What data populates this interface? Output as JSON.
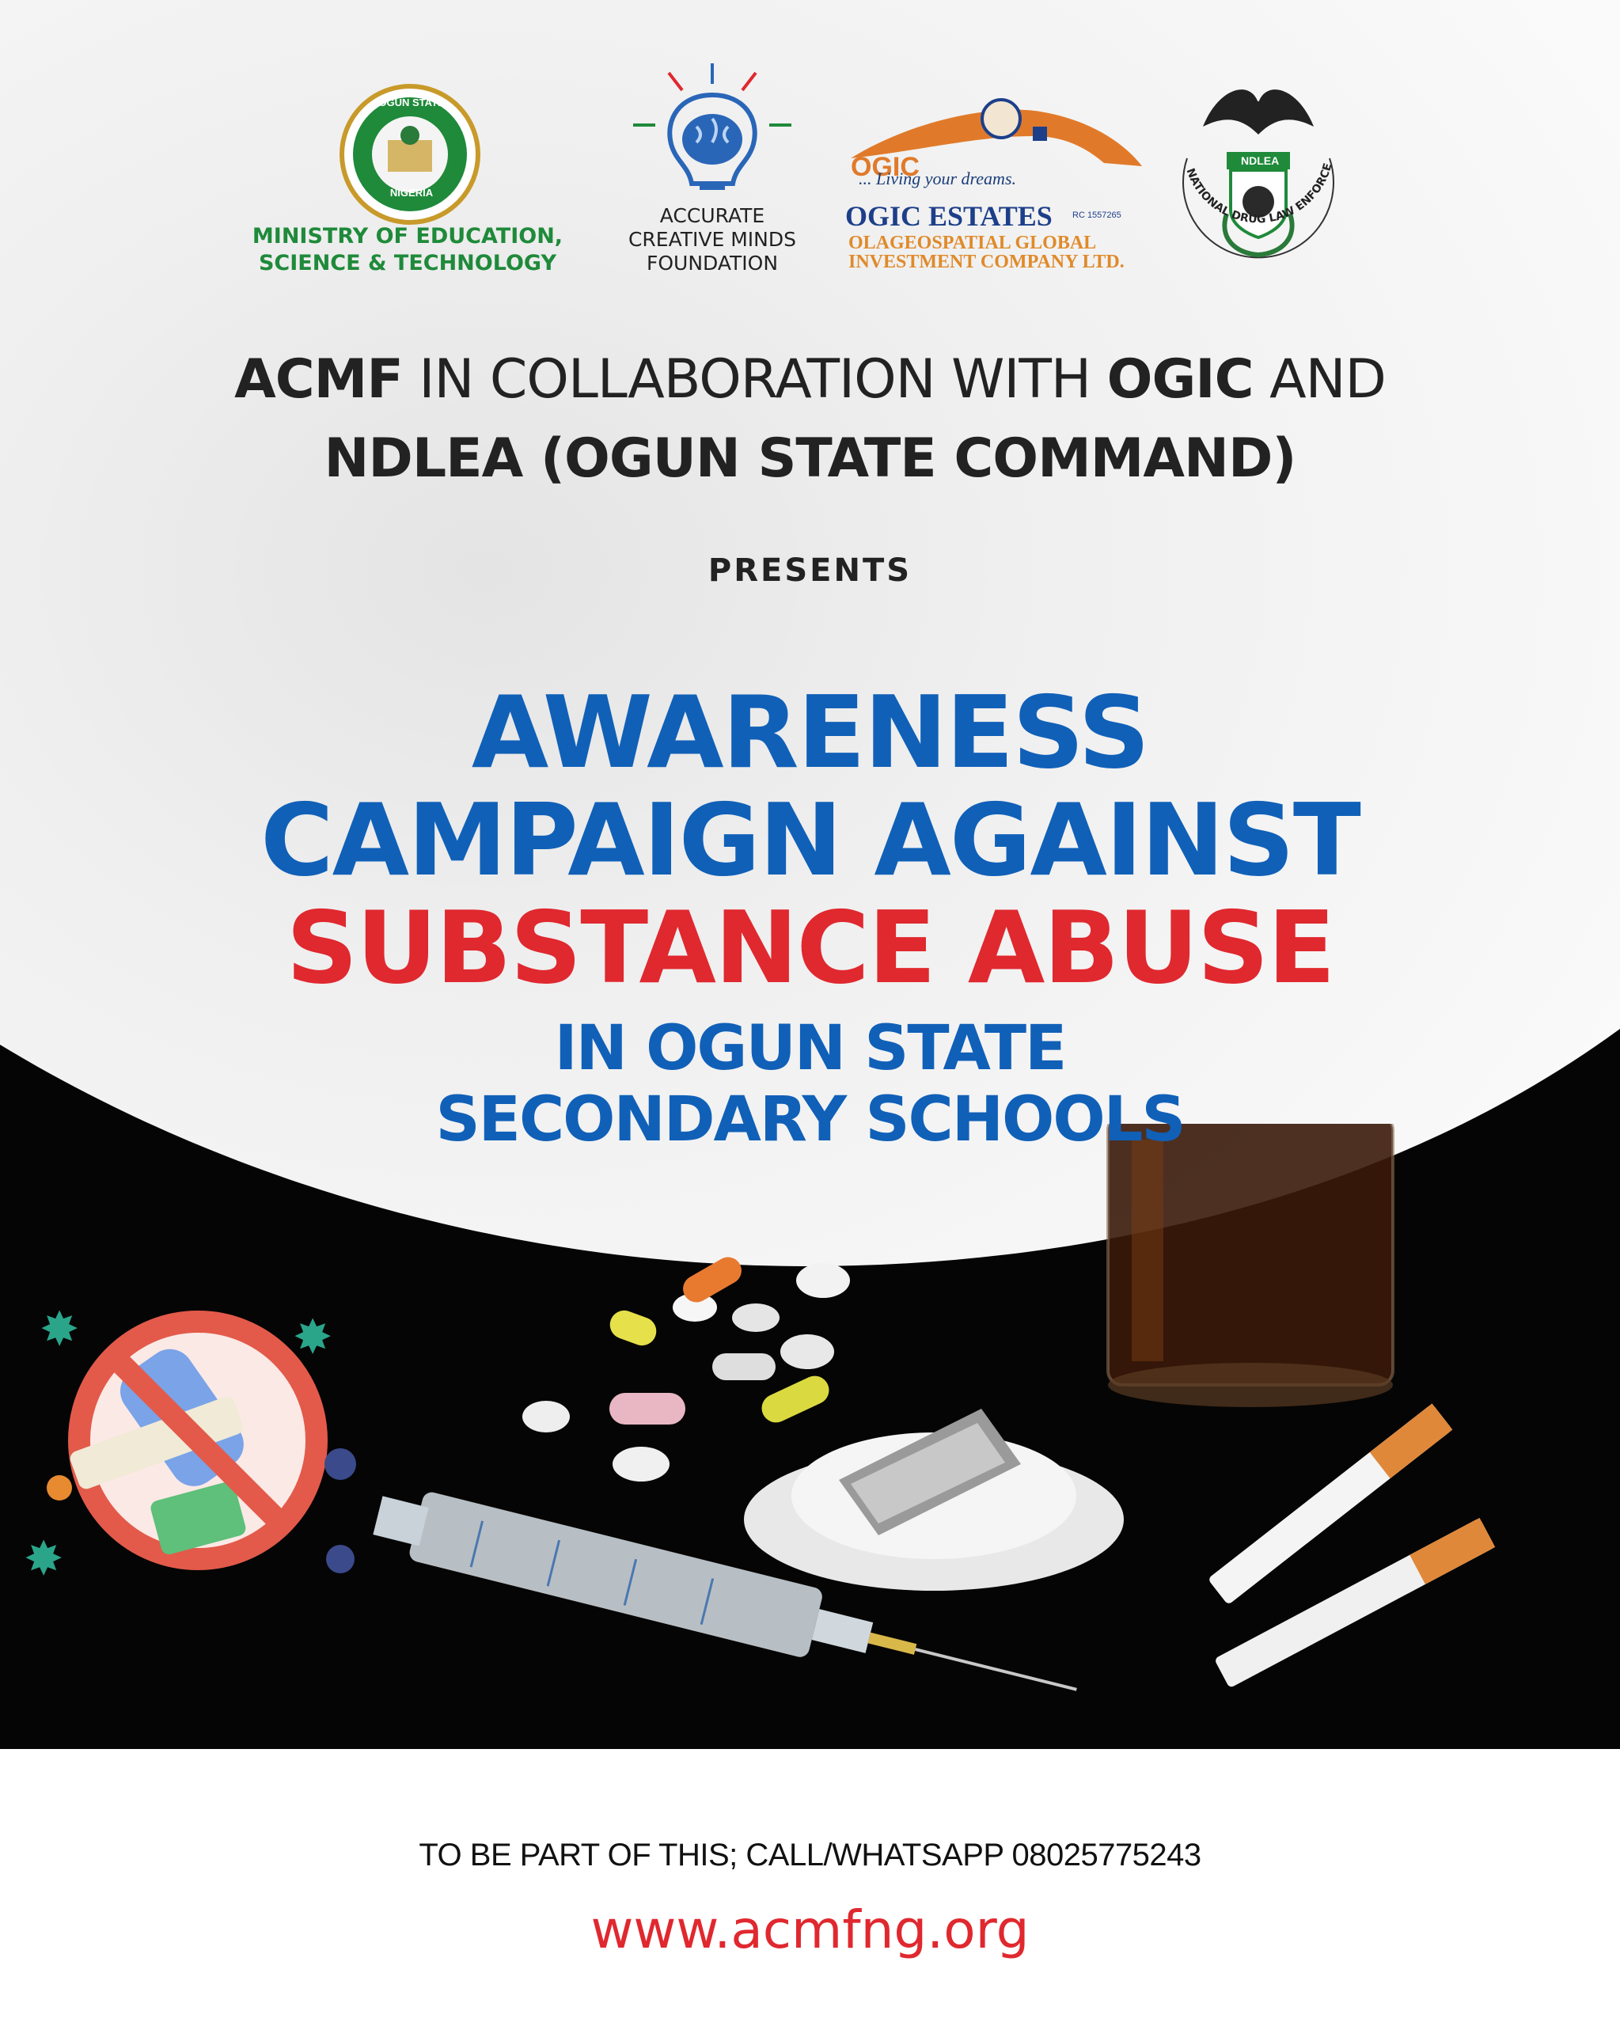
{
  "logos": {
    "ministry": {
      "seal_text_top": "OGUN STATE",
      "seal_text_bottom": "NIGERIA",
      "caption_line1": "MINISTRY OF EDUCATION,",
      "caption_line2": "SCIENCE & TECHNOLOGY"
    },
    "acmf": {
      "caption_line1": "ACCURATE",
      "caption_line2": "CREATIVE MINDS",
      "caption_line3": "FOUNDATION"
    },
    "ogic": {
      "short": "OGIC",
      "tagline": "... Living your dreams.",
      "name": "OGIC ESTATES",
      "rc": "RC 1557265",
      "sub_line1": "OLAGEOSPATIAL GLOBAL",
      "sub_line2": "INVESTMENT COMPANY LTD."
    },
    "ndlea": {
      "badge_text": "NDLEA",
      "ring_text": "NATIONAL DRUG LAW ENFORCEMENT AGENCY"
    }
  },
  "collab": {
    "line1_part1": "ACMF",
    "line1_part2": " IN COLLABORATION WITH ",
    "line1_part3": "OGIC",
    "line1_part4": " AND",
    "line2": "NDLEA (OGUN STATE COMMAND)"
  },
  "presents": "PRESENTS",
  "title": {
    "line1": "AWARENESS",
    "line2": "CAMPAIGN AGAINST",
    "line3": "SUBSTANCE ABUSE",
    "line4": "IN OGUN STATE",
    "line5": "SECONDARY SCHOOLS"
  },
  "footer": {
    "contact": "TO BE PART OF THIS; CALL/WHATSAPP 08025775243",
    "website": "www.acmfng.org"
  },
  "colors": {
    "blue": "#1060b8",
    "red": "#e0282f",
    "green": "#1f8a3a",
    "orange": "#e07a2a",
    "dark": "#050505"
  }
}
